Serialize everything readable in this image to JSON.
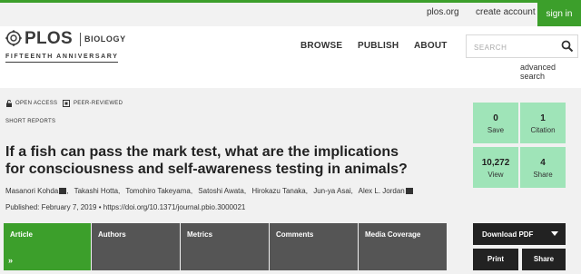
{
  "colors": {
    "brand_green": "#3c9f2b",
    "metric_bg": "#9fe4b8",
    "tab_bg": "#555555",
    "dark_button": "#222222"
  },
  "utility": {
    "links": [
      "plos.org",
      "create account"
    ],
    "signin": "sign in"
  },
  "logo": {
    "mark_icon": "plos-logo-icon",
    "name": "PLOS",
    "journal": "BIOLOGY",
    "anniversary": "FIFTEENTH ANNIVERSARY"
  },
  "nav": [
    "BROWSE",
    "PUBLISH",
    "ABOUT"
  ],
  "search": {
    "placeholder": "SEARCH",
    "icon": "search-icon",
    "advanced": "advanced search"
  },
  "article": {
    "badges": [
      {
        "icon": "open-access-lock-icon",
        "label": "OPEN ACCESS"
      },
      {
        "icon": "peer-reviewed-icon",
        "label": "PEER-REVIEWED"
      }
    ],
    "type": "SHORT REPORTS",
    "title_line1": "If a fish can pass the mark test, what are the implications",
    "title_line2": "for consciousness and self-awareness testing in animals?",
    "authors": [
      "Masanori Kohda",
      "Takashi Hotta",
      "Tomohiro Takeyama",
      "Satoshi Awata",
      "Hirokazu Tanaka",
      "Jun-ya Asai",
      "Alex L. Jordan"
    ],
    "published": "Published: February 7, 2019",
    "doi": "https://doi.org/10.1371/journal.pbio.3000021"
  },
  "tabs": [
    "Article",
    "Authors",
    "Metrics",
    "Comments",
    "Media Coverage"
  ],
  "metrics": [
    {
      "value": "0",
      "label": "Save"
    },
    {
      "value": "1",
      "label": "Citation"
    },
    {
      "value": "10,272",
      "label": "View"
    },
    {
      "value": "4",
      "label": "Share"
    }
  ],
  "actions": {
    "download": "Download PDF",
    "print": "Print",
    "share": "Share"
  }
}
